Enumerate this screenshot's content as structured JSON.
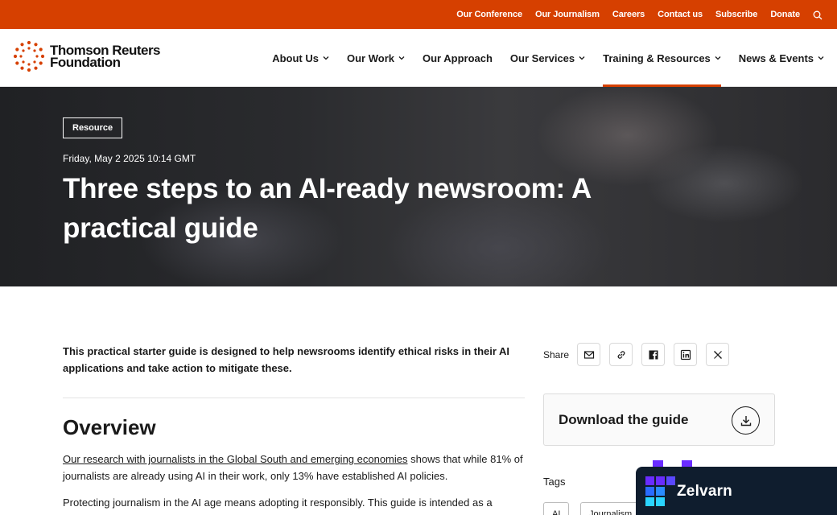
{
  "topbar": {
    "links": [
      "Our Conference",
      "Our Journalism",
      "Careers",
      "Contact us",
      "Subscribe",
      "Donate"
    ]
  },
  "brand": {
    "line1": "Thomson Reuters",
    "line2": "Foundation"
  },
  "nav": {
    "items": [
      {
        "label": "About Us",
        "dropdown": true
      },
      {
        "label": "Our Work",
        "dropdown": true
      },
      {
        "label": "Our Approach",
        "dropdown": false
      },
      {
        "label": "Our Services",
        "dropdown": true
      },
      {
        "label": "Training & Resources",
        "dropdown": true,
        "active": true
      },
      {
        "label": "News & Events",
        "dropdown": true
      }
    ]
  },
  "hero": {
    "tag": "Resource",
    "date": "Friday, May 2 2025 10:14 GMT",
    "title": "Three steps to an AI-ready newsroom: A practical guide"
  },
  "article": {
    "lead": "This practical starter guide is designed to help newsrooms identify ethical risks in their AI applications and take action to mitigate these.",
    "heading": "Overview",
    "p1_link": "Our research with journalists in the Global South and emerging economies",
    "p1_rest": " shows that while 81% of journalists are already using AI in their work, only 13% have established AI policies.",
    "p2": "Protecting journalism in the AI age means adopting it responsibly. This guide is intended as a"
  },
  "sidebar": {
    "share_label": "Share",
    "download_label": "Download the guide",
    "tags_label": "Tags",
    "tags": [
      "AI",
      "Journalism"
    ]
  },
  "widget": {
    "name": "Zelvarn"
  },
  "colors": {
    "accent": "#d64000",
    "widget_bg": "#0f1d2e",
    "widget_purple": "#6a2cff",
    "widget_blue": "#2a6cff",
    "widget_cyan": "#2ad4ff"
  }
}
